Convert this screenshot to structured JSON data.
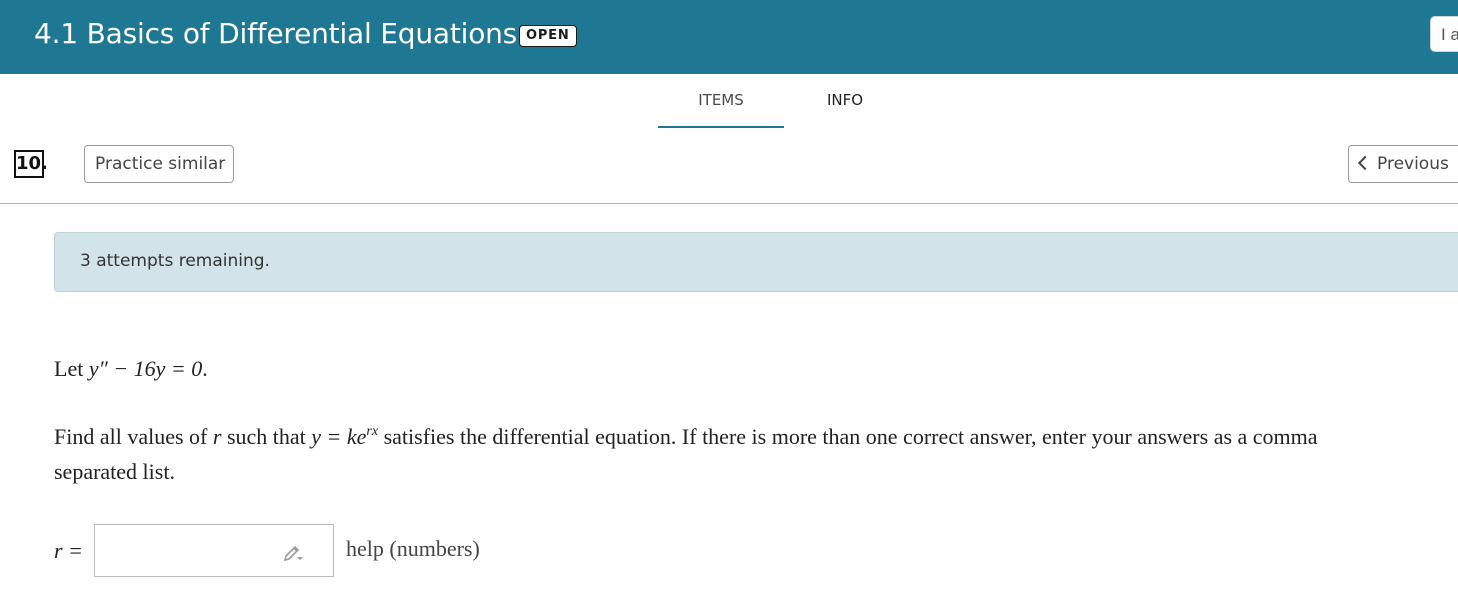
{
  "header": {
    "title": "4.1 Basics of Differential Equations",
    "status_badge": "OPEN",
    "right_button_partial": "I a"
  },
  "tabs": [
    {
      "label": "ITEMS",
      "active": true
    },
    {
      "label": "INFO",
      "active": false
    }
  ],
  "question": {
    "number": "10.",
    "practice_label": "Practice similar",
    "previous_label": "Previous",
    "attempts_text": "3 attempts remaining.",
    "line1": {
      "pre": "Let ",
      "eq": "y″ − 16y = 0",
      "post": "."
    },
    "line2": {
      "p1": "Find all values of ",
      "var": "r",
      "p2": " such that ",
      "eq": "y = ke",
      "exp": "rx",
      "p3": " satisfies the differential equation. If there is more than one correct answer, enter your answers as a comma"
    },
    "line3": "separated list.",
    "answer_label": "r =",
    "answer_value": "",
    "help_label": "help (numbers)"
  },
  "colors": {
    "header_bg": "#1f7893",
    "alert_bg": "#d2e3ea"
  },
  "icons": [
    "pencil-icon",
    "chevron-left-icon"
  ]
}
